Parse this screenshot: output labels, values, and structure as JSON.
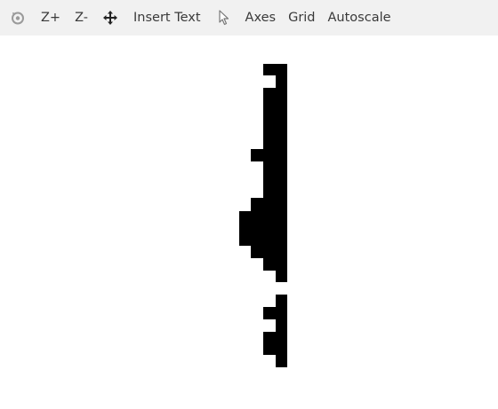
{
  "toolbar": {
    "items": [
      {
        "kind": "icon",
        "icon": "reset-icon"
      },
      {
        "kind": "text",
        "label": "Z+"
      },
      {
        "kind": "text",
        "label": "Z-"
      },
      {
        "kind": "icon",
        "icon": "move-icon"
      },
      {
        "kind": "text",
        "label": "Insert Text"
      },
      {
        "kind": "icon",
        "icon": "pointer-icon"
      },
      {
        "kind": "text",
        "label": "Axes"
      },
      {
        "kind": "text",
        "label": "Grid"
      },
      {
        "kind": "text",
        "label": "Autoscale"
      }
    ]
  },
  "colors": {
    "toolbar_bg": "#f1f1f1",
    "text": "#3a3a3a",
    "shape_fill": "#000000",
    "canvas_bg": "#ffffff"
  }
}
